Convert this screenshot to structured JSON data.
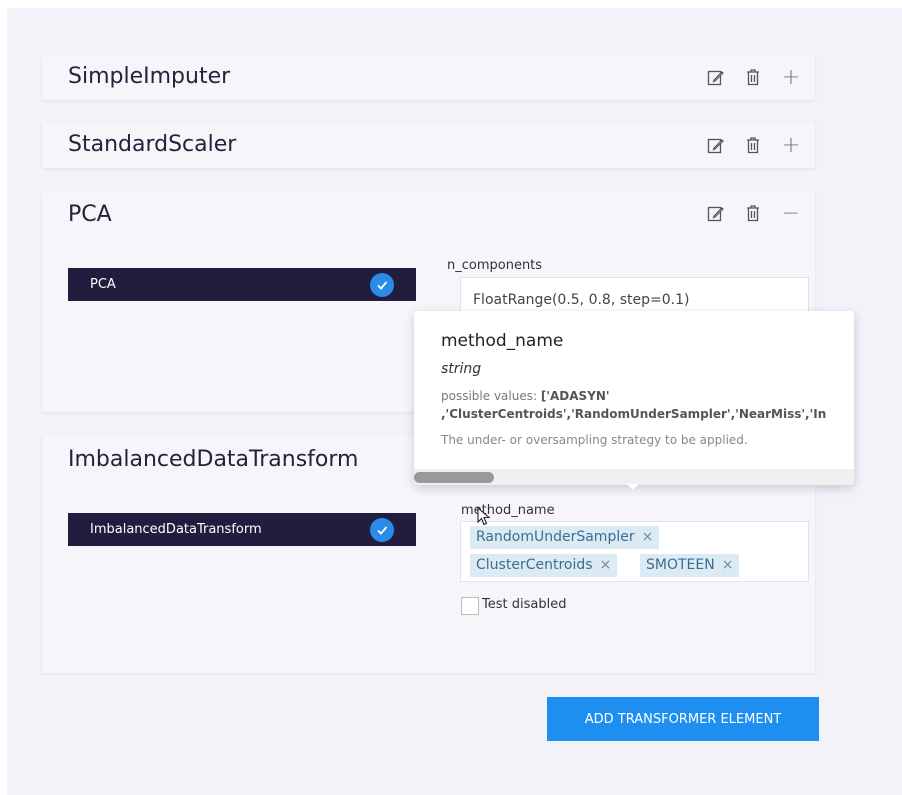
{
  "cards": [
    {
      "title": "SimpleImputer",
      "toggle": "+"
    },
    {
      "title": "StandardScaler",
      "toggle": "+"
    },
    {
      "title": "PCA",
      "toggle": "−"
    },
    {
      "title": "ImbalancedDataTransform"
    }
  ],
  "pca": {
    "chip_label": "PCA",
    "field_label": "n_components",
    "field_value": "FloatRange(0.5, 0.8, step=0.1)"
  },
  "imbalanced": {
    "chip_label": "ImbalancedDataTransform",
    "field_label": "method_name",
    "tags": [
      "RandomUnderSampler",
      "ClusterCentroids",
      "SMOTEEN"
    ],
    "tag_remove": "×",
    "checkbox_label": "Test disabled"
  },
  "tooltip": {
    "title": "method_name",
    "type": "string",
    "possible_values_label": "possible values:",
    "possible_values_line1": "['ADASYN'",
    "possible_values_line2": ",'ClusterCentroids','RandomUnderSampler','NearMiss','In",
    "description": "The under- or oversampling strategy to be applied."
  },
  "add_button": "ADD TRANSFORMER ELEMENT",
  "colors": {
    "chip_bg": "#211d3e",
    "check": "#2b8ce8",
    "button": "#1e8ff0",
    "tag_bg": "#dceaf4"
  }
}
